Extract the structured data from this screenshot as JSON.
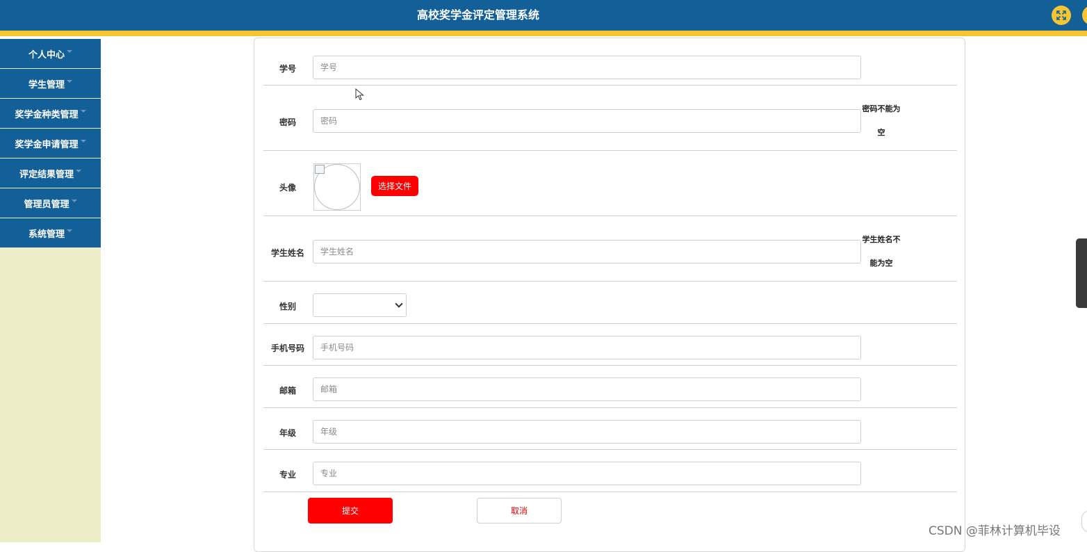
{
  "header": {
    "title": "高校奖学金评定管理系统",
    "fullscreen_icon": "fullscreen-icon"
  },
  "sidebar": {
    "items": [
      {
        "label": "个人中心"
      },
      {
        "label": "学生管理"
      },
      {
        "label": "奖学金种类管理"
      },
      {
        "label": "奖学金申请管理"
      },
      {
        "label": "评定结果管理"
      },
      {
        "label": "管理员管理"
      },
      {
        "label": "系统管理"
      }
    ]
  },
  "form": {
    "student_id": {
      "label": "学号",
      "placeholder": "学号",
      "value": ""
    },
    "password": {
      "label": "密码",
      "placeholder": "密码",
      "value": "",
      "error": "密码不能为空"
    },
    "avatar": {
      "label": "头像",
      "button_label": "选择文件"
    },
    "student_name": {
      "label": "学生姓名",
      "placeholder": "学生姓名",
      "value": "",
      "error": "学生姓名不能为空"
    },
    "gender": {
      "label": "性别",
      "selected": ""
    },
    "phone": {
      "label": "手机号码",
      "placeholder": "手机号码",
      "value": ""
    },
    "email": {
      "label": "邮箱",
      "placeholder": "邮箱",
      "value": ""
    },
    "grade": {
      "label": "年级",
      "placeholder": "年级",
      "value": ""
    },
    "major": {
      "label": "专业",
      "placeholder": "专业",
      "value": ""
    },
    "submit_label": "提交",
    "cancel_label": "取消"
  },
  "watermark": "CSDN @菲林计算机毕设",
  "colors": {
    "header": "#135f98",
    "accent_stripe": "#f5c532",
    "sidebar_bg": "#ededc8",
    "primary_button": "#ff0000"
  }
}
